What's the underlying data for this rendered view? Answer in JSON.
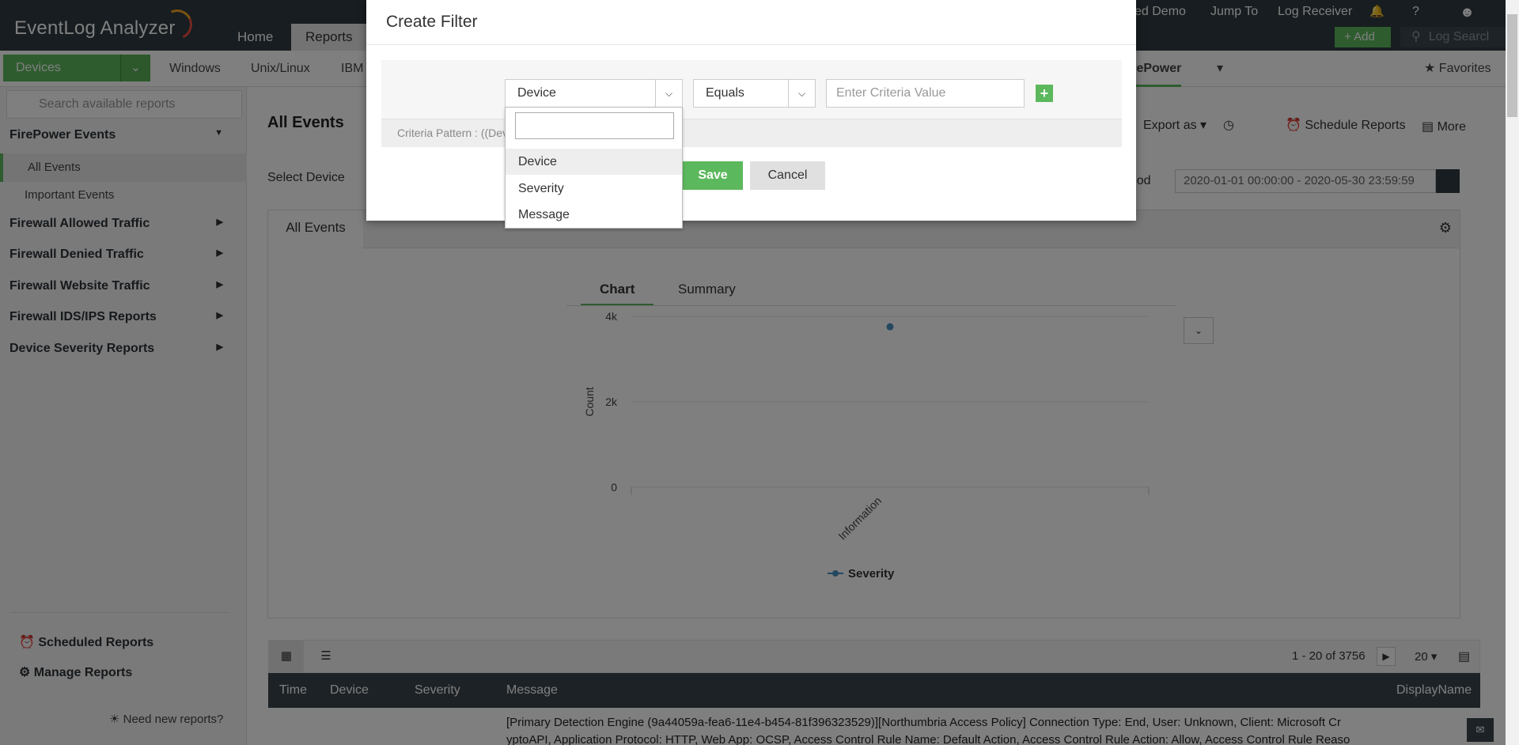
{
  "app": {
    "title": "EventLog Analyzer"
  },
  "top_nav": {
    "home": "Home",
    "reports": "Reports"
  },
  "top_right": {
    "demo": "zed Demo",
    "jump_to": "Jump To",
    "log_receiver": "Log Receiver",
    "help": "?",
    "add_label": "Add",
    "log_search": "Log Searcl"
  },
  "device_bar": {
    "selected": "Devices",
    "tabs": [
      "Windows",
      "Unix/Linux",
      "IBM",
      "FirePower"
    ],
    "favorites": "Favorites"
  },
  "sidebar": {
    "search_placeholder": "Search available reports",
    "group_title": "FirePower Events",
    "sub_items": [
      "All Events",
      "Important Events"
    ],
    "groups": [
      "Firewall Allowed Traffic",
      "Firewall Denied Traffic",
      "Firewall Website Traffic",
      "Firewall IDS/IPS Reports",
      "Device Severity Reports"
    ],
    "scheduled": "Scheduled Reports",
    "manage": "Manage Reports",
    "need_new": "Need new reports?"
  },
  "content": {
    "title": "All Events",
    "export_as": "Export as",
    "schedule_reports": "Schedule Reports",
    "more": "More",
    "select_device": "Select Device",
    "period_label": "eriod",
    "period_value": "2020-01-01 00:00:00 - 2020-05-30 23:59:59",
    "panel_tab": "All Events",
    "chart_tab": "Chart",
    "summary_tab": "Summary"
  },
  "chart_data": {
    "type": "line",
    "categories": [
      "Information"
    ],
    "series": [
      {
        "name": "Severity",
        "values": [
          3756
        ]
      }
    ],
    "ylabel": "Count",
    "xlabel": "",
    "ylim": [
      0,
      4000
    ],
    "yticks": [
      "4k",
      "2k",
      "0"
    ],
    "legend": "bottom"
  },
  "table": {
    "pagination": "1 - 20 of 3756",
    "page_size": "20",
    "columns": [
      "Time",
      "Device",
      "Severity",
      "Message",
      "DisplayName"
    ],
    "row_text_1": "[Primary Detection Engine (9a44059a-fea6-11e4-b454-81f396323529)][Northumbria Access Policy] Connection Type: End, User: Unknown, Client: Microsoft Cr",
    "row_text_2": "yptoAPI, Application Protocol: HTTP, Web App: OCSP, Access Control Rule Name: Default Action, Access Control Rule Action: Allow, Access Control Rule Reaso"
  },
  "modal": {
    "title": "Create Filter",
    "field_select": "Device",
    "operator_select": "Equals",
    "value_placeholder": "Enter Criteria Value",
    "add_symbol": "+",
    "criteria_pattern": "Criteria Pattern : ((Dev",
    "save": "Save",
    "cancel": "Cancel",
    "dropdown_options": [
      "Device",
      "Severity",
      "Message"
    ]
  },
  "colors": {
    "accent": "#5cb85c",
    "header": "#2f3a40",
    "series": "#4a90c2"
  }
}
